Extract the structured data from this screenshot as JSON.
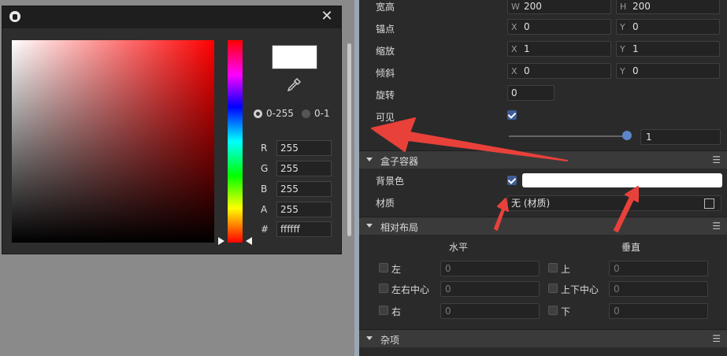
{
  "picker": {
    "mode_255": "0-255",
    "mode_1": "0-1",
    "preview_color": "#ffffff",
    "channels": [
      {
        "label": "R",
        "value": "255"
      },
      {
        "label": "G",
        "value": "255"
      },
      {
        "label": "B",
        "value": "255"
      },
      {
        "label": "A",
        "value": "255"
      },
      {
        "label": "#",
        "value": "ffffff"
      }
    ]
  },
  "inspector": {
    "size": {
      "label": "宽高",
      "w_axis": "W",
      "w": "200",
      "h_axis": "H",
      "h": "200"
    },
    "anchor": {
      "label": "锚点",
      "x_axis": "X",
      "x": "0",
      "y_axis": "Y",
      "y": "0"
    },
    "scale": {
      "label": "缩放",
      "x_axis": "X",
      "x": "1",
      "y_axis": "Y",
      "y": "1"
    },
    "skew": {
      "label": "倾斜",
      "x_axis": "X",
      "x": "0",
      "y_axis": "Y",
      "y": "0"
    },
    "rotation": {
      "label": "旋转",
      "value": "0"
    },
    "visible": {
      "label": "可见",
      "checked": true
    },
    "alpha": {
      "value": "1",
      "level": 1
    },
    "box_section": {
      "title": "盒子容器",
      "menu": "☰"
    },
    "bg_color": {
      "label": "背景色",
      "checked": true,
      "color": "#ffffff"
    },
    "material": {
      "label": "材质",
      "value": "无 (材质)"
    },
    "layout_section": {
      "title": "相对布局",
      "menu": "☰",
      "horizontal": "水平",
      "vertical": "垂直"
    },
    "layout_rows": [
      {
        "left_label": "左",
        "left_value": "0",
        "right_label": "上",
        "right_value": "0"
      },
      {
        "left_label": "左右中心",
        "left_value": "0",
        "right_label": "上下中心",
        "right_value": "0"
      },
      {
        "left_label": "右",
        "left_value": "0",
        "right_label": "下",
        "right_value": "0"
      }
    ],
    "misc_section": {
      "title": "杂项",
      "menu": "☰"
    }
  },
  "colors": {
    "accent": "#3d5c95",
    "arrow": "#e8413a",
    "panel": "#2a2a2a"
  }
}
